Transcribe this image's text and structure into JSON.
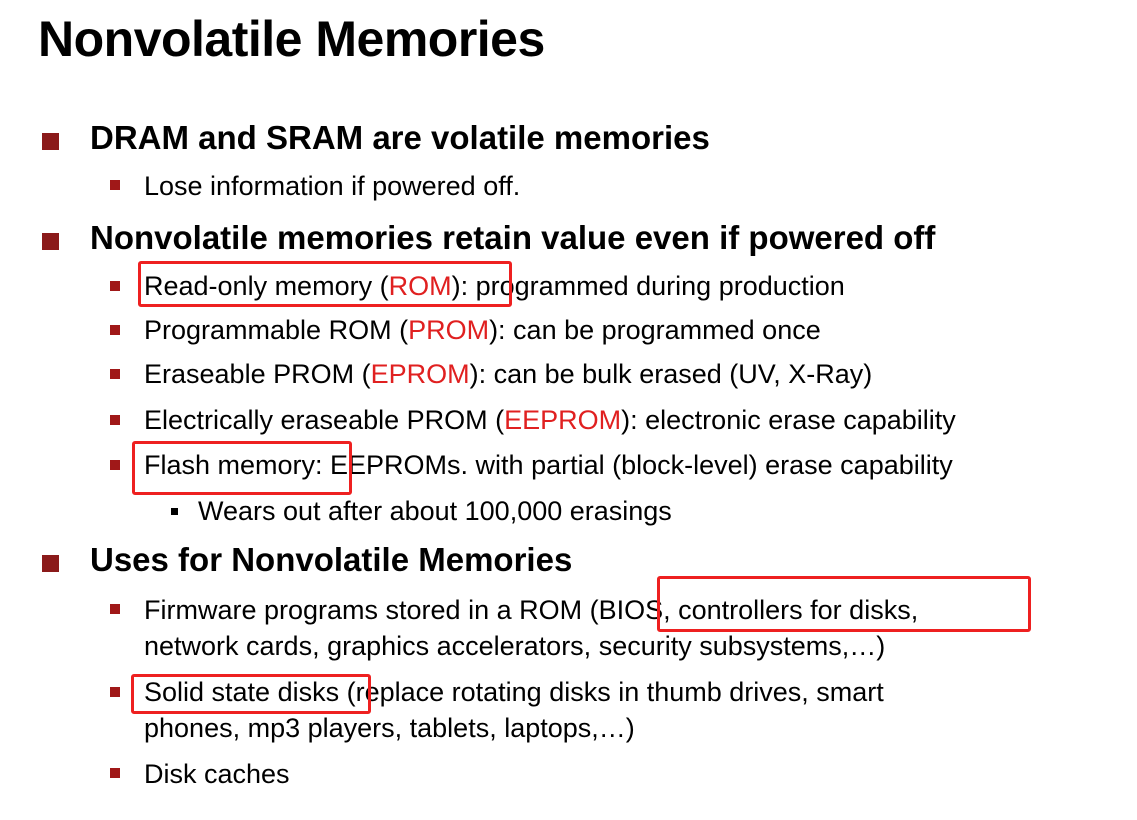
{
  "title": "Nonvolatile Memories",
  "sections": [
    {
      "heading": "DRAM and SRAM are volatile memories",
      "items": [
        {
          "text": "Lose information if powered off."
        }
      ]
    },
    {
      "heading": "Nonvolatile memories retain value even if powered off",
      "items": [
        {
          "pre": "Read-only memory (",
          "acronym": "ROM",
          "post": "): programmed during production"
        },
        {
          "pre": "Programmable ROM (",
          "acronym": "PROM",
          "post": "): can be programmed once"
        },
        {
          "pre": "Eraseable PROM (",
          "acronym": "EPROM",
          "post": "): can be bulk erased (UV, X-Ray)"
        },
        {
          "pre": "Electrically eraseable PROM (",
          "acronym": "EEPROM",
          "post": "): electronic erase capability"
        },
        {
          "text": "Flash memory: EEPROMs. with partial (block-level) erase capability",
          "subitems": [
            "Wears out after about 100,000 erasings"
          ]
        }
      ]
    },
    {
      "heading": "Uses for Nonvolatile Memories",
      "items": [
        {
          "line1": "Firmware programs stored in a ROM (BIOS, controllers for disks,",
          "line2": "network cards, graphics accelerators, security subsystems,…)"
        },
        {
          "line1": "Solid state disks (replace rotating disks in thumb drives, smart",
          "line2": "phones, mp3 players, tablets, laptops,…)"
        },
        {
          "text": "Disk caches"
        }
      ]
    }
  ],
  "colors": {
    "bullet_primary": "#8b1a1a",
    "acronym": "#e02020",
    "highlight_box": "#ee2020"
  }
}
